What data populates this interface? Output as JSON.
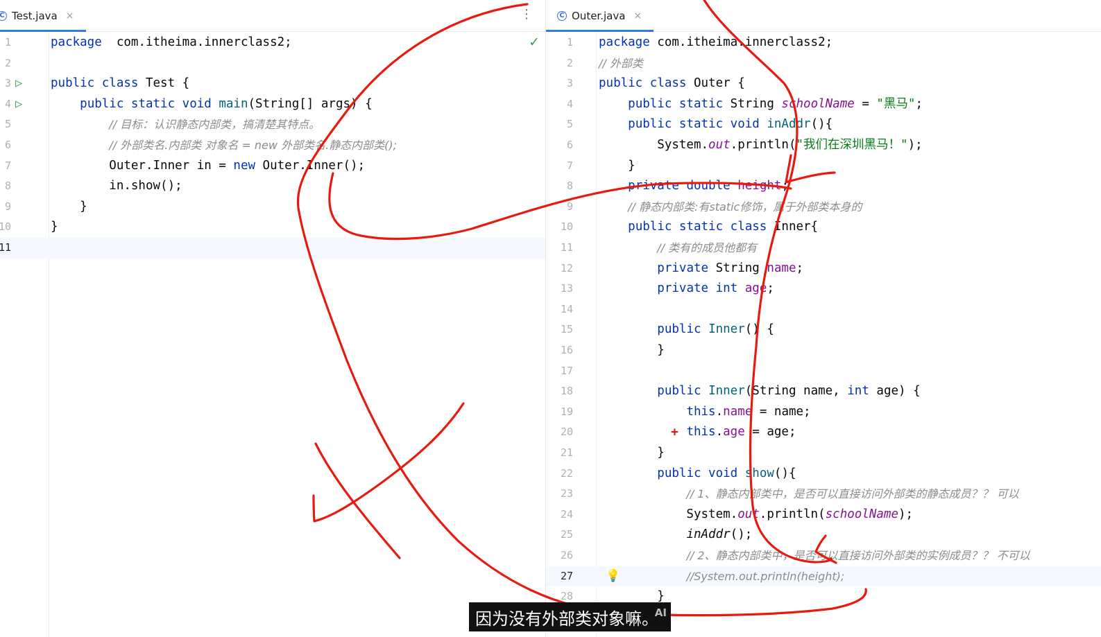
{
  "left_editor": {
    "tab": {
      "icon": "java-class-icon",
      "label": "Test.java",
      "close": "×"
    },
    "menu": "⋮",
    "status": "✓",
    "lines": [
      {
        "n": "1",
        "tokens": [
          [
            "kw",
            "package"
          ],
          [
            "",
            "  com.itheima.innerclass2;"
          ]
        ]
      },
      {
        "n": "2",
        "tokens": []
      },
      {
        "n": "3",
        "run": true,
        "tokens": [
          [
            "kw",
            "public class"
          ],
          [
            "",
            " Test {"
          ]
        ]
      },
      {
        "n": "4",
        "run": true,
        "tokens": [
          [
            "",
            "    "
          ],
          [
            "kw",
            "public static void"
          ],
          [
            "",
            " "
          ],
          [
            "fn",
            "main"
          ],
          [
            "",
            "(String[] args) {"
          ]
        ]
      },
      {
        "n": "5",
        "tokens": [
          [
            "",
            "        "
          ],
          [
            "cm",
            "// 目标：认识静态内部类，搞清楚其特点。"
          ]
        ]
      },
      {
        "n": "6",
        "tokens": [
          [
            "",
            "        "
          ],
          [
            "cm",
            "// 外部类名.内部类 对象名 = new 外部类名.静态内部类();"
          ]
        ]
      },
      {
        "n": "7",
        "tokens": [
          [
            "",
            "        Outer.Inner in = "
          ],
          [
            "kw",
            "new"
          ],
          [
            "",
            " Outer.Inner();"
          ]
        ]
      },
      {
        "n": "8",
        "tokens": [
          [
            "",
            "        in.show();"
          ]
        ]
      },
      {
        "n": "9",
        "tokens": [
          [
            "",
            "    }"
          ]
        ]
      },
      {
        "n": "10",
        "tokens": [
          [
            "",
            "}"
          ]
        ]
      },
      {
        "n": "11",
        "current": true,
        "tokens": []
      }
    ]
  },
  "right_editor": {
    "tab": {
      "icon": "java-class-icon",
      "label": "Outer.java",
      "close": "×"
    },
    "lines": [
      {
        "n": "1",
        "tokens": [
          [
            "kw",
            "package"
          ],
          [
            "",
            " com.itheima.innerclass2;"
          ]
        ]
      },
      {
        "n": "2",
        "tokens": [
          [
            "cm",
            "// 外部类"
          ]
        ]
      },
      {
        "n": "3",
        "tokens": [
          [
            "kw",
            "public class"
          ],
          [
            "",
            " Outer {"
          ]
        ]
      },
      {
        "n": "4",
        "tokens": [
          [
            "",
            "    "
          ],
          [
            "kw",
            "public static"
          ],
          [
            "",
            " String "
          ],
          [
            "fld it",
            "schoolName"
          ],
          [
            "",
            " = "
          ],
          [
            "str",
            "\"黑马\""
          ],
          [
            "",
            ";"
          ]
        ]
      },
      {
        "n": "5",
        "tokens": [
          [
            "",
            "    "
          ],
          [
            "kw",
            "public static void"
          ],
          [
            "",
            " "
          ],
          [
            "fn",
            "inAddr"
          ],
          [
            "",
            "(){"
          ]
        ]
      },
      {
        "n": "6",
        "tokens": [
          [
            "",
            "        System."
          ],
          [
            "fld it",
            "out"
          ],
          [
            "",
            ".println("
          ],
          [
            "str",
            "\"我们在深圳黑马！\""
          ],
          [
            "",
            ");"
          ]
        ]
      },
      {
        "n": "7",
        "tokens": [
          [
            "",
            "    }"
          ]
        ]
      },
      {
        "n": "8",
        "tokens": [
          [
            "",
            "    "
          ],
          [
            "kw",
            "private double"
          ],
          [
            "",
            " "
          ],
          [
            "fld",
            "height"
          ],
          [
            "",
            ";"
          ]
        ]
      },
      {
        "n": "9",
        "tokens": [
          [
            "",
            "    "
          ],
          [
            "cm",
            "// 静态内部类:有static修饰，属于外部类本身的"
          ]
        ]
      },
      {
        "n": "10",
        "tokens": [
          [
            "",
            "    "
          ],
          [
            "kw",
            "public static class"
          ],
          [
            "",
            " Inner{"
          ]
        ]
      },
      {
        "n": "11",
        "tokens": [
          [
            "",
            "        "
          ],
          [
            "cm",
            "// 类有的成员他都有"
          ]
        ]
      },
      {
        "n": "12",
        "tokens": [
          [
            "",
            "        "
          ],
          [
            "kw",
            "private"
          ],
          [
            "",
            " String "
          ],
          [
            "fld",
            "name"
          ],
          [
            "",
            ";"
          ]
        ]
      },
      {
        "n": "13",
        "tokens": [
          [
            "",
            "        "
          ],
          [
            "kw",
            "private int"
          ],
          [
            "",
            " "
          ],
          [
            "fld",
            "age"
          ],
          [
            "",
            ";"
          ]
        ]
      },
      {
        "n": "14",
        "tokens": []
      },
      {
        "n": "15",
        "tokens": [
          [
            "",
            "        "
          ],
          [
            "kw",
            "public"
          ],
          [
            "",
            " "
          ],
          [
            "fn",
            "Inner"
          ],
          [
            "",
            "() {"
          ]
        ]
      },
      {
        "n": "16",
        "tokens": [
          [
            "",
            "        }"
          ]
        ]
      },
      {
        "n": "17",
        "tokens": []
      },
      {
        "n": "18",
        "tokens": [
          [
            "",
            "        "
          ],
          [
            "kw",
            "public"
          ],
          [
            "",
            " "
          ],
          [
            "fn",
            "Inner"
          ],
          [
            "",
            "(String name, "
          ],
          [
            "kw",
            "int"
          ],
          [
            "",
            " age) {"
          ]
        ]
      },
      {
        "n": "19",
        "tokens": [
          [
            "",
            "            "
          ],
          [
            "kw",
            "this"
          ],
          [
            "",
            "."
          ],
          [
            "fld",
            "name"
          ],
          [
            "",
            " = name;"
          ]
        ]
      },
      {
        "n": "20",
        "plus": true,
        "tokens": [
          [
            "",
            "            "
          ],
          [
            "kw",
            "this"
          ],
          [
            "",
            "."
          ],
          [
            "fld",
            "age"
          ],
          [
            "",
            " = age;"
          ]
        ]
      },
      {
        "n": "21",
        "tokens": [
          [
            "",
            "        }"
          ]
        ]
      },
      {
        "n": "22",
        "tokens": [
          [
            "",
            "        "
          ],
          [
            "kw",
            "public void"
          ],
          [
            "",
            " "
          ],
          [
            "fn",
            "show"
          ],
          [
            "",
            "(){"
          ]
        ]
      },
      {
        "n": "23",
        "tokens": [
          [
            "",
            "            "
          ],
          [
            "cm",
            "// 1、静态内部类中，是否可以直接访问外部类的静态成员？？ 可以"
          ]
        ]
      },
      {
        "n": "24",
        "tokens": [
          [
            "",
            "            System."
          ],
          [
            "fld it",
            "out"
          ],
          [
            "",
            ".println("
          ],
          [
            "fld it",
            "schoolName"
          ],
          [
            "",
            ");"
          ]
        ]
      },
      {
        "n": "25",
        "tokens": [
          [
            "",
            "            "
          ],
          [
            "it",
            "inAddr"
          ],
          [
            "",
            "();"
          ]
        ]
      },
      {
        "n": "26",
        "tokens": [
          [
            "",
            "            "
          ],
          [
            "cm",
            "// 2、静态内部类中，是否可以直接访问外部类的实例成员？？ 不可以"
          ]
        ]
      },
      {
        "n": "27",
        "current": true,
        "bulb": true,
        "tokens": [
          [
            "",
            "            "
          ],
          [
            "cm",
            "//System.out.println(height);"
          ]
        ]
      },
      {
        "n": "28",
        "tokens": [
          [
            "",
            "        }"
          ]
        ]
      }
    ]
  },
  "subtitle": {
    "text": "因为没有外部类对象嘛。",
    "badge": "AI"
  },
  "ink_color": "#e8190f"
}
